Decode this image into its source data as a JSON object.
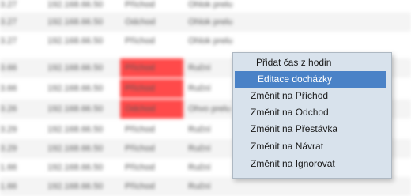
{
  "table": {
    "rows": [
      {
        "time": "3.27",
        "ip": "192.168.66.50",
        "type": "Příchod",
        "desc": "Ohlok prelu",
        "alt": false,
        "highlight": false
      },
      {
        "time": "3.27",
        "ip": "192.168.66.50",
        "type": "Odchod",
        "desc": "Ohlok prelu",
        "alt": true,
        "highlight": false
      },
      {
        "time": "3.27",
        "ip": "192.168.66.50",
        "type": "Příchod",
        "desc": "Ohlok prelu",
        "alt": false,
        "highlight": false
      },
      {
        "time": "3.66",
        "ip": "192.168.66.50",
        "type": "Příchod",
        "desc": "Ruční",
        "alt": true,
        "highlight": true
      },
      {
        "time": "3.66",
        "ip": "192.168.66.50",
        "type": "Příchod",
        "desc": "Ruční",
        "alt": false,
        "highlight": true
      },
      {
        "time": "3.26",
        "ip": "192.168.66.50",
        "type": "Odchod",
        "desc": "Ohvo prelu",
        "alt": true,
        "highlight": true
      },
      {
        "time": "3.29",
        "ip": "192.168.66.50",
        "type": "Příchod",
        "desc": "Ruční",
        "alt": false,
        "highlight": false
      },
      {
        "time": "3.29",
        "ip": "192.168.66.50",
        "type": "Příchod",
        "desc": "Ruční",
        "alt": true,
        "highlight": false
      },
      {
        "time": "1.66",
        "ip": "192.168.66.50",
        "type": "Příchod",
        "desc": "Ruční",
        "alt": false,
        "highlight": false
      },
      {
        "time": "1.66",
        "ip": "192.168.66.50",
        "type": "Příchod",
        "desc": "Ruční",
        "alt": true,
        "highlight": false
      }
    ]
  },
  "context_menu": {
    "items": [
      {
        "label": "Přidat čas z hodin",
        "selected": false
      },
      {
        "label": "Editace docházky",
        "selected": true
      },
      {
        "label": "Změnit na Příchod",
        "selected": false
      },
      {
        "label": "Změnit na Odchod",
        "selected": false
      },
      {
        "label": "Změnit na Přestávka",
        "selected": false
      },
      {
        "label": "Změnit na Návrat",
        "selected": false
      },
      {
        "label": "Změnit na Ignorovat",
        "selected": false
      }
    ]
  },
  "colors": {
    "highlight": "#ff4a4a",
    "menu_background": "#d8e2ec",
    "menu_selected": "#4a82c7"
  }
}
